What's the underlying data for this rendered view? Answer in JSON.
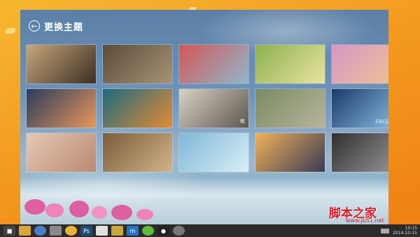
{
  "header": {
    "title": "更换主题"
  },
  "themes": [
    {
      "name": "kitten-piano",
      "colors": [
        "#c7a77a",
        "#3d2f24"
      ]
    },
    {
      "name": "bulldog-newspaper",
      "colors": [
        "#5c4b3b",
        "#a89375"
      ]
    },
    {
      "name": "maple-leaves",
      "colors": [
        "#d45757",
        "#8fb7cc"
      ]
    },
    {
      "name": "tree-on-hill",
      "colors": [
        "#8db14f",
        "#e9e3a0"
      ]
    },
    {
      "name": "golden-gate-sunset",
      "colors": [
        "#d797c8",
        "#f0c38f"
      ]
    },
    {
      "name": "evening-bay",
      "colors": [
        "#2a3b5d",
        "#e8975a"
      ]
    },
    {
      "name": "cartoon-fish",
      "colors": [
        "#1c6b7f",
        "#e48a33"
      ]
    },
    {
      "name": "anime-girl-sketch",
      "colors": [
        "#d9d2c4",
        "#5e5750"
      ]
    },
    {
      "name": "grey-cat-grass",
      "colors": [
        "#7a8b63",
        "#b7b49b"
      ]
    },
    {
      "name": "frozen",
      "colors": [
        "#1b3a6b",
        "#8cc1e6"
      ]
    },
    {
      "name": "sleepy-kitten",
      "colors": [
        "#e7c9b5",
        "#b98a72"
      ]
    },
    {
      "name": "lying-cat",
      "colors": [
        "#7b5b3a",
        "#d3b489"
      ]
    },
    {
      "name": "kids-on-shore",
      "colors": [
        "#7fb8d8",
        "#d8eef6"
      ]
    },
    {
      "name": "sunset-beach",
      "colors": [
        "#f0b15a",
        "#3b3b55"
      ]
    },
    {
      "name": "dark-anime",
      "colors": [
        "#2f2f2f",
        "#9a9a9a"
      ]
    }
  ],
  "tile_labels": {
    "anime-girl-sketch": "蛛",
    "frozen": "FROZEN"
  },
  "taskbar": {
    "items": [
      "start",
      "explorer",
      "browser",
      "media",
      "paint",
      "ps",
      "docs",
      "notes",
      "chat",
      "qq",
      "ie"
    ],
    "clock_time": "10:15",
    "clock_date": "2014-10-15"
  },
  "watermark": {
    "text": "脚本之家",
    "sub": "www.jb51.net"
  }
}
